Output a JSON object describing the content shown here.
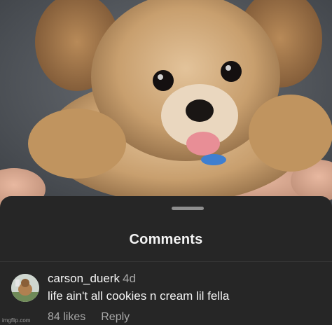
{
  "sheet": {
    "title": "Comments"
  },
  "comment": {
    "username": "carson_duerk",
    "time": "4d",
    "text": "life ain't all cookies n cream lil fella",
    "likes": "84 likes",
    "reply_label": "Reply"
  },
  "watermark": "imgflip.com",
  "colors": {
    "sheet_bg": "#262626",
    "text_primary": "#f5f5f5",
    "text_secondary": "#a8a8a8",
    "fur": "#c89f6e"
  }
}
